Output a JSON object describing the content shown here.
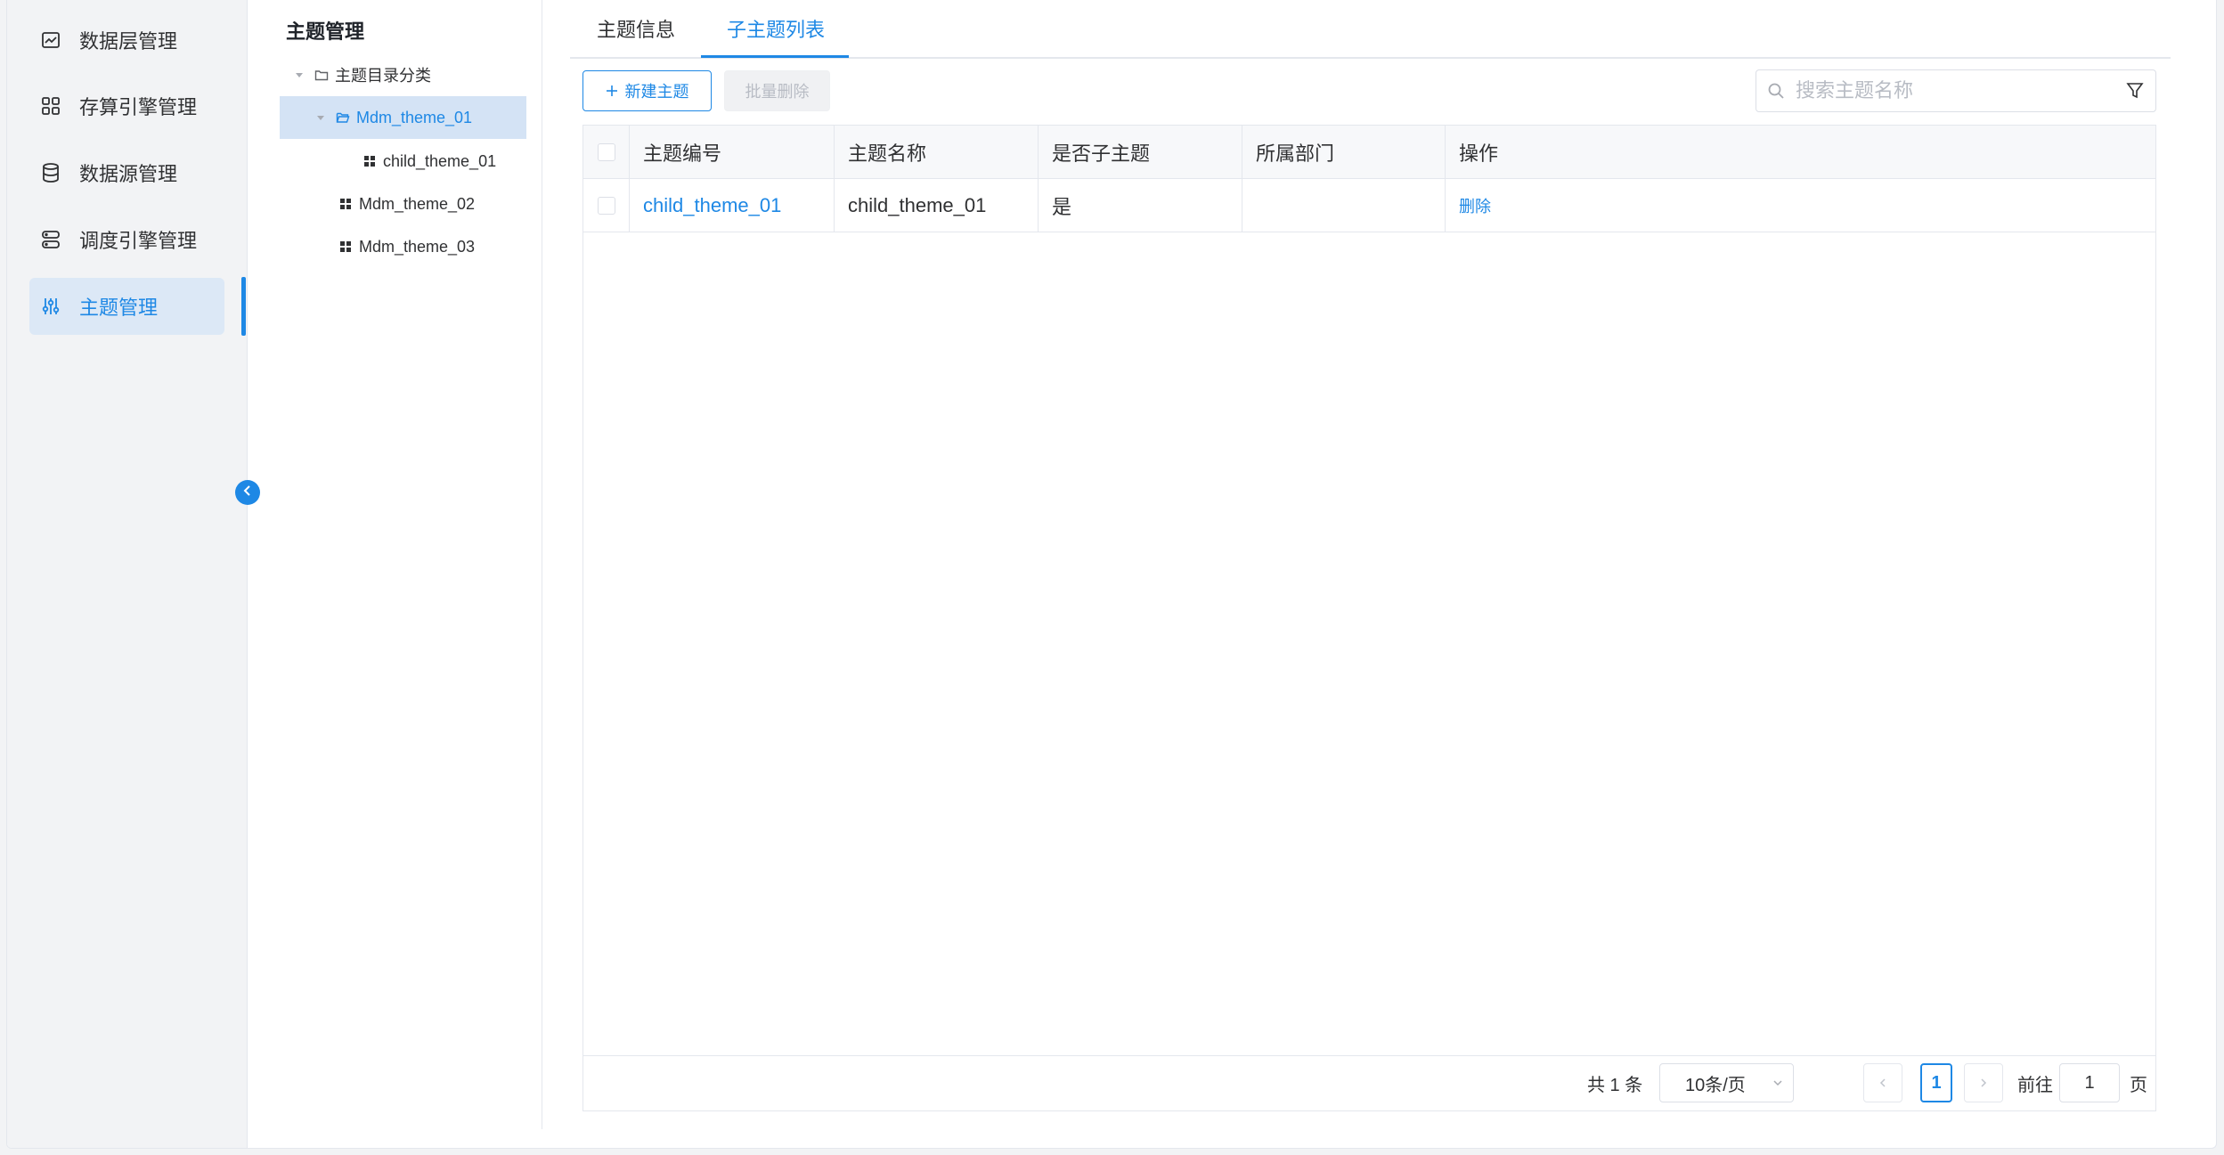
{
  "nav": {
    "items": [
      {
        "label": "数据层管理",
        "icon": "image-icon",
        "active": false
      },
      {
        "label": "存算引擎管理",
        "icon": "grid-icon",
        "active": false
      },
      {
        "label": "数据源管理",
        "icon": "database-icon",
        "active": false
      },
      {
        "label": "调度引擎管理",
        "icon": "server-icon",
        "active": false
      },
      {
        "label": "主题管理",
        "icon": "sliders-icon",
        "active": true
      }
    ]
  },
  "tree": {
    "title": "主题管理",
    "nodes": [
      {
        "label": "主题目录分类",
        "icon": "folder-icon",
        "expanded": true
      },
      {
        "label": "Mdm_theme_01",
        "icon": "folder-open-icon",
        "expanded": true,
        "selected": true
      },
      {
        "label": "child_theme_01",
        "icon": "grid-icon"
      },
      {
        "label": "Mdm_theme_02",
        "icon": "grid-icon"
      },
      {
        "label": "Mdm_theme_03",
        "icon": "grid-icon"
      }
    ]
  },
  "tabs": [
    {
      "label": "主题信息",
      "active": false
    },
    {
      "label": "子主题列表",
      "active": true
    }
  ],
  "toolbar": {
    "new_label": "新建主题",
    "batch_delete_label": "批量删除",
    "search_placeholder": "搜索主题名称",
    "search_value": ""
  },
  "table": {
    "columns": [
      "主题编号",
      "主题名称",
      "是否子主题",
      "所属部门",
      "操作"
    ],
    "rows": [
      {
        "code": "child_theme_01",
        "name": "child_theme_01",
        "is_child": "是",
        "department": "",
        "action": "删除"
      }
    ]
  },
  "pagination": {
    "total_text": "共 1 条",
    "page_size": "10条/页",
    "current_page": "1",
    "goto_label": "前往",
    "goto_value": "1",
    "page_suffix": "页"
  },
  "colors": {
    "accent": "#1e88e5",
    "nav_bg": "#f2f3f5",
    "active_bg": "#dce8f6"
  }
}
